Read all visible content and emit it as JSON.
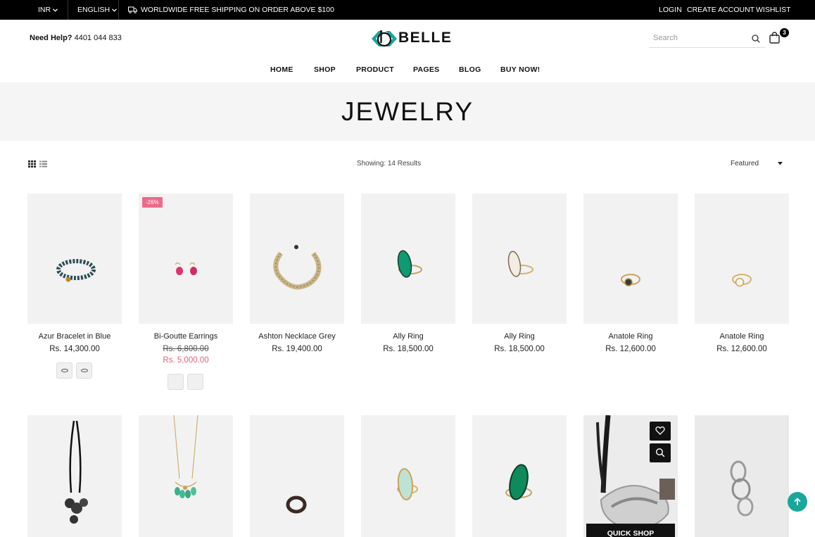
{
  "topbar": {
    "currency": "INR",
    "language": "ENGLISH",
    "shipping": "WORLDWIDE FREE SHIPPING ON ORDER ABOVE $100",
    "login": "LOGIN",
    "create_account": "CREATE ACCOUNT",
    "wishlist": "WISHLIST"
  },
  "header": {
    "help_label": "Need Help?",
    "help_phone": "4401 044 833",
    "logo_text": "BELLE",
    "search_placeholder": "Search",
    "cart_count": "3"
  },
  "nav": {
    "items": [
      "HOME",
      "SHOP",
      "PRODUCT",
      "PAGES",
      "BLOG",
      "BUY NOW!"
    ]
  },
  "page": {
    "title": "JEWELRY",
    "results": "Showing: 14 Results",
    "sort_selected": "Featured"
  },
  "products": [
    {
      "name": "Azur Bracelet in Blue",
      "price": "Rs. 14,300.00"
    },
    {
      "name": "Bi-Goutte Earrings",
      "old_price": "Rs. 6,800.00",
      "sale_price": "Rs. 5,000.00",
      "badge": "-26%"
    },
    {
      "name": "Ashton Necklace Grey",
      "price": "Rs. 19,400.00"
    },
    {
      "name": "Ally Ring",
      "price": "Rs. 18,500.00"
    },
    {
      "name": "Ally Ring",
      "price": "Rs. 18,500.00"
    },
    {
      "name": "Anatole Ring",
      "price": "Rs. 12,600.00"
    },
    {
      "name": "Anatole Ring",
      "price": "Rs. 12,600.00"
    }
  ],
  "hover_card": {
    "quick_shop": "QUICK SHOP"
  },
  "colors": {
    "accent": "#18a79a",
    "sale": "#e95d7d",
    "badge": "#ec6a8b",
    "topbar": "#000000"
  },
  "icons": [
    "truck-icon",
    "search-icon",
    "cart-icon",
    "grid-view-icon",
    "list-view-icon",
    "heart-icon",
    "zoom-icon",
    "arrow-up-icon"
  ]
}
